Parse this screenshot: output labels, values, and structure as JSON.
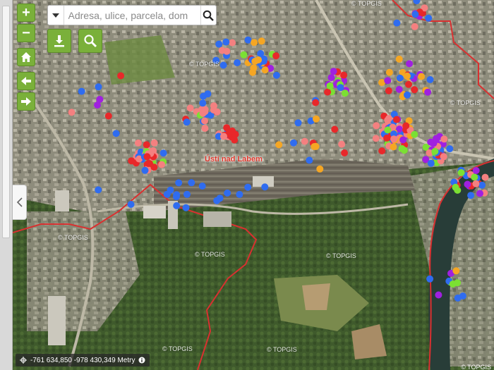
{
  "search": {
    "placeholder": "Adresa, ulice, parcela, dom"
  },
  "controls": {
    "zoom_in": "+",
    "zoom_out": "−"
  },
  "map": {
    "place_label": "Ústí nad Labem",
    "watermark": "© TOPGIS",
    "coordinates": "-761 634,850 -978 430,349 Metry"
  },
  "colors": {
    "marker_red": "#e8282a",
    "marker_pink": "#f48080",
    "marker_blue": "#2f6cf0",
    "marker_orange": "#f5a623",
    "marker_purple": "#a020e0",
    "marker_green": "#7be033",
    "border_red": "#d93030",
    "button_green": "#7ab03a"
  },
  "icons": [
    "plus-icon",
    "minus-icon",
    "home-icon",
    "arrow-left-icon",
    "arrow-right-icon",
    "chevron-down-icon",
    "search-icon",
    "download-icon",
    "magnifier-icon",
    "chevron-left-icon",
    "crosshair-icon",
    "info-icon"
  ]
}
